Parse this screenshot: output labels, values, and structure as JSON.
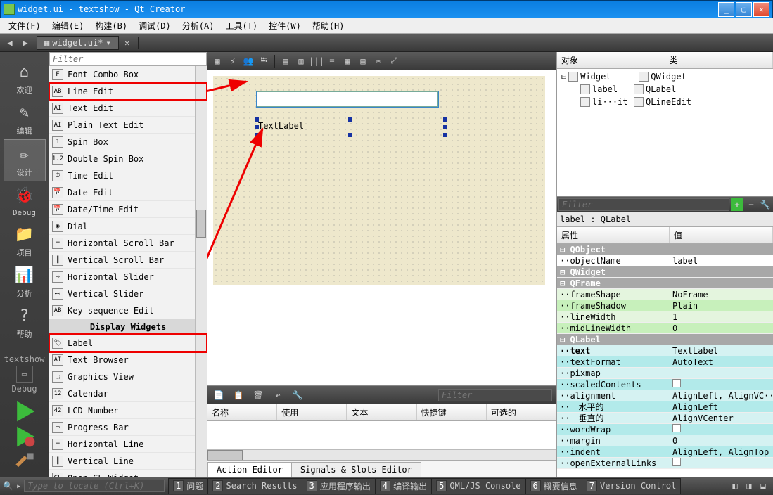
{
  "title": "widget.ui - textshow - Qt Creator",
  "menus": [
    "文件(F)",
    "编辑(E)",
    "构建(B)",
    "调试(D)",
    "分析(A)",
    "工具(T)",
    "控件(W)",
    "帮助(H)"
  ],
  "doc_tab": "widget.ui*",
  "modes": [
    {
      "label": "欢迎",
      "icon": "home-icon"
    },
    {
      "label": "编辑",
      "icon": "edit-icon"
    },
    {
      "label": "设计",
      "icon": "design-icon",
      "sel": true
    },
    {
      "label": "Debug",
      "icon": "bug-icon"
    },
    {
      "label": "项目",
      "icon": "project-icon"
    },
    {
      "label": "分析",
      "icon": "analyze-icon"
    },
    {
      "label": "帮助",
      "icon": "help-icon"
    }
  ],
  "kit_name": "textshow",
  "kit_config": "Debug",
  "palette_filter": "Filter",
  "palette_items": [
    {
      "i": "F",
      "t": "Font Combo Box"
    },
    {
      "i": "AB",
      "t": "Line Edit",
      "red": true
    },
    {
      "i": "AI",
      "t": "Text Edit"
    },
    {
      "i": "AI",
      "t": "Plain Text Edit"
    },
    {
      "i": "1",
      "t": "Spin Box"
    },
    {
      "i": "1.2",
      "t": "Double Spin Box"
    },
    {
      "i": "⏱",
      "t": "Time Edit"
    },
    {
      "i": "📅",
      "t": "Date Edit"
    },
    {
      "i": "📅",
      "t": "Date/Time Edit"
    },
    {
      "i": "◉",
      "t": "Dial"
    },
    {
      "i": "═",
      "t": "Horizontal Scroll Bar"
    },
    {
      "i": "║",
      "t": "Vertical Scroll Bar"
    },
    {
      "i": "⊸",
      "t": "Horizontal Slider"
    },
    {
      "i": "⊷",
      "t": "Vertical Slider"
    },
    {
      "i": "AB",
      "t": "Key sequence Edit"
    },
    {
      "cat": true,
      "t": "Display Widgets"
    },
    {
      "i": "🏷",
      "t": "Label",
      "red": true
    },
    {
      "i": "AI",
      "t": "Text Browser"
    },
    {
      "i": "⬚",
      "t": "Graphics View"
    },
    {
      "i": "12",
      "t": "Calendar"
    },
    {
      "i": "42",
      "t": "LCD Number"
    },
    {
      "i": "▭",
      "t": "Progress Bar"
    },
    {
      "i": "═",
      "t": "Horizontal Line"
    },
    {
      "i": "║",
      "t": "Vertical Line"
    },
    {
      "i": "GL",
      "t": "Open GL Widget"
    }
  ],
  "canvas_label": "TextLabel",
  "action_filter": "Filter",
  "action_headers": [
    "名称",
    "使用",
    "文本",
    "快捷键",
    "可选的"
  ],
  "action_tabs": [
    "Action Editor",
    "Signals & Slots Editor"
  ],
  "oi_headers": [
    "对象",
    "类"
  ],
  "oi_rows": [
    {
      "ind": 0,
      "name": "Widget",
      "cls": "QWidget"
    },
    {
      "ind": 1,
      "name": "label",
      "cls": "QLabel"
    },
    {
      "ind": 1,
      "name": "li···it",
      "cls": "QLineEdit"
    }
  ],
  "prop_filter": "Filter",
  "prop_path": "label : QLabel",
  "prop_headers": [
    "属性",
    "值"
  ],
  "prop_rows": [
    {
      "sec": true,
      "n": "QObject"
    },
    {
      "n": "objectName",
      "v": "label"
    },
    {
      "sec": true,
      "n": "QWidget"
    },
    {
      "sec": true,
      "n": "QFrame"
    },
    {
      "cls": "g1",
      "n": "frameShape",
      "v": "NoFrame"
    },
    {
      "cls": "g2",
      "n": "frameShadow",
      "v": "Plain"
    },
    {
      "cls": "g1",
      "n": "lineWidth",
      "v": "1"
    },
    {
      "cls": "g2",
      "n": "midLineWidth",
      "v": "0"
    },
    {
      "sec": true,
      "n": "QLabel"
    },
    {
      "cls": "b1",
      "n": "text",
      "v": "TextLabel",
      "bold": true
    },
    {
      "cls": "b2",
      "n": "textFormat",
      "v": "AutoText"
    },
    {
      "cls": "b1",
      "n": "pixmap",
      "v": ""
    },
    {
      "cls": "b2",
      "n": "scaledContents",
      "v": "",
      "chk": true
    },
    {
      "cls": "b1",
      "n": "alignment",
      "v": "AlignLeft, AlignVC···"
    },
    {
      "cls": "b2",
      "n": "　水平的",
      "v": "AlignLeft"
    },
    {
      "cls": "b1",
      "n": "　垂直的",
      "v": "AlignVCenter"
    },
    {
      "cls": "b2",
      "n": "wordWrap",
      "v": "",
      "chk": true
    },
    {
      "cls": "b1",
      "n": "margin",
      "v": "0"
    },
    {
      "cls": "b2",
      "n": "indent",
      "v": "AlignLeft, AlignTop"
    },
    {
      "cls": "b1",
      "n": "openExternalLinks",
      "v": "",
      "chk": true
    }
  ],
  "locator_placeholder": "Type to locate (Ctrl+K)",
  "bottom_panes": [
    {
      "n": "1",
      "t": "问题"
    },
    {
      "n": "2",
      "t": "Search Results"
    },
    {
      "n": "3",
      "t": "应用程序输出"
    },
    {
      "n": "4",
      "t": "编译输出"
    },
    {
      "n": "5",
      "t": "QML/JS Console"
    },
    {
      "n": "6",
      "t": "概要信息"
    },
    {
      "n": "7",
      "t": "Version Control"
    }
  ]
}
